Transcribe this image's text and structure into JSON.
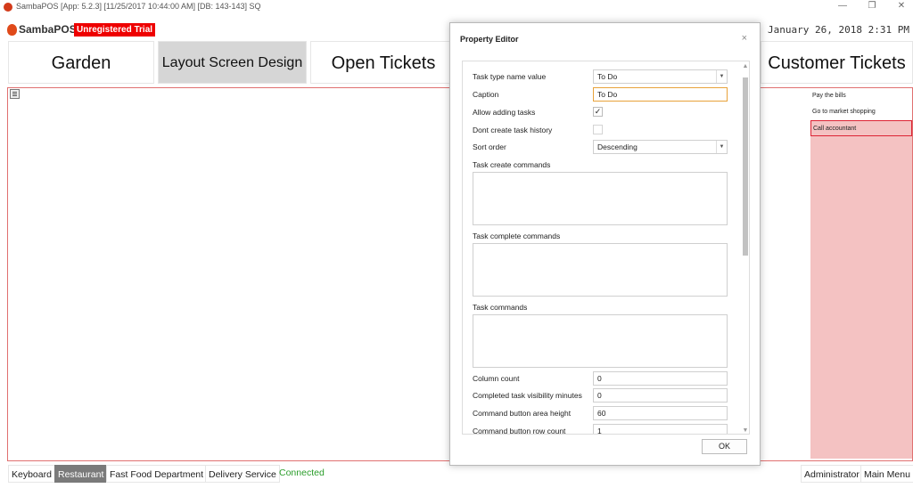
{
  "window": {
    "title": "SambaPOS [App: 5.2.3] [11/25/2017 10:44:00 AM] [DB: 143-143] SQ",
    "minimize_glyph": "—",
    "restore_glyph": "❐",
    "close_glyph": "✕"
  },
  "header": {
    "logo_text": "SambaPOS",
    "trial_badge": "Unregistered Trial",
    "datetime": "ay, January 26, 2018 2:31 PM",
    "colors": {
      "brand": "#e04a1a",
      "badge": "#ee0000"
    }
  },
  "nav": {
    "garden": "Garden",
    "layout_screen_design": "Layout Screen Design",
    "open_tickets": "Open Tickets",
    "customer_tickets": "Customer Tickets"
  },
  "task_widget": {
    "items": [
      "Pay the bills",
      "Go to market shopping",
      "Call accountant"
    ],
    "selected_index": 2,
    "accent_color": "#f4c2c2"
  },
  "dialog": {
    "title": "Property Editor",
    "close_glyph": "×",
    "fields": {
      "task_type_name_value": {
        "label": "Task type name value",
        "value": "To Do"
      },
      "caption": {
        "label": "Caption",
        "value": "To Do"
      },
      "allow_adding_tasks": {
        "label": "Allow adding tasks",
        "checked": true,
        "mark": "✓"
      },
      "dont_create_task_history": {
        "label": "Dont create task history",
        "checked": false,
        "mark": ""
      },
      "sort_order": {
        "label": "Sort order",
        "value": "Descending"
      },
      "task_create_commands": {
        "label": "Task create commands",
        "value": ""
      },
      "task_complete_commands": {
        "label": "Task complete commands",
        "value": ""
      },
      "task_commands": {
        "label": "Task commands",
        "value": ""
      },
      "column_count": {
        "label": "Column count",
        "value": "0"
      },
      "completed_task_visibility_minutes": {
        "label": "Completed task visibility minutes",
        "value": "0"
      },
      "command_button_area_height": {
        "label": "Command button area height",
        "value": "60"
      },
      "command_button_row_count": {
        "label": "Command button row count",
        "value": "1"
      }
    },
    "ok_label": "OK"
  },
  "bottom_bar": {
    "keyboard": "Keyboard",
    "restaurant": "Restaurant",
    "fast_food_department": "Fast Food Department",
    "delivery_service": "Delivery Service",
    "status": "Connected",
    "user": "Administrator",
    "main_menu": "Main Menu"
  }
}
